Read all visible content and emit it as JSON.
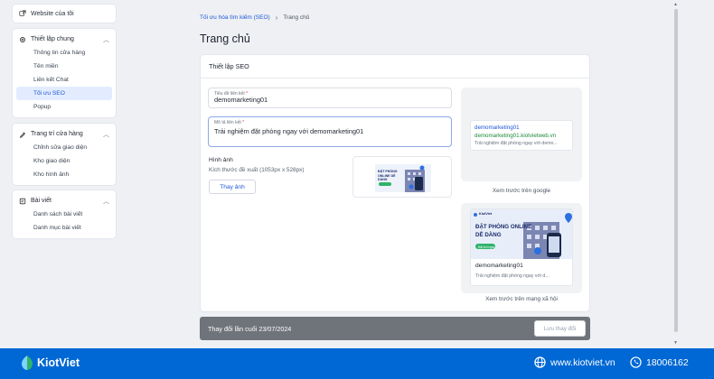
{
  "sidebar": {
    "top_item": "Website của tôi",
    "groups": [
      {
        "title": "Thiết lập chung",
        "items": [
          "Thông tin cửa hàng",
          "Tên miền",
          "Liên kết Chat",
          "Tối ưu SEO",
          "Popup"
        ]
      },
      {
        "title": "Trang trí cửa hàng",
        "items": [
          "Chỉnh sửa giao diện",
          "Kho giao diện",
          "Kho hình ảnh"
        ]
      },
      {
        "title": "Bài viết",
        "items": [
          "Danh sách bài viết",
          "Danh mục bài viết"
        ]
      }
    ],
    "active_item": "Tối ưu SEO"
  },
  "breadcrumb": {
    "parent": "Tối ưu hóa tìm kiếm (SEO)",
    "current": "Trang chủ"
  },
  "page_title": "Trang chủ",
  "seo_card": {
    "title": "Thiết lập SEO",
    "link_title_label": "Tiêu đề liên kết",
    "link_title_value": "demomarketing01",
    "link_desc_label": "Mô tả liên kết",
    "link_desc_value": "Trải nghiệm đặt phòng ngay với demomarketing01",
    "required_mark": "*",
    "image_title": "Hình ảnh",
    "image_hint": "Kích thước đề xuất (1053px x 528px)",
    "change_image_button": "Thay ảnh",
    "thumbnail_text": "ĐẶT PHÒNG ONLINE DỄ DÀNG"
  },
  "google_preview": {
    "title": "demomarketing01",
    "url": "demomarketing01.kiotvietweb.vn",
    "description": "Trải nghiệm đặt phòng ngay với demo...",
    "caption": "Xem trước trên google"
  },
  "social_preview": {
    "banner_brand": "KiotViet",
    "banner_line1": "ĐẶT PHÒNG ONLINE",
    "banner_line2": "DỄ DÀNG",
    "banner_button": "Đặt lịch ngay",
    "title": "demomarketing01",
    "description": "Trải nghiệm đặt phòng ngay với d...",
    "caption": "Xem trước trên mạng xã hội"
  },
  "save_bar": {
    "last_modified": "Thay đổi lần cuối 23/07/2024",
    "save_button": "Lưu thay đổi"
  },
  "footer": {
    "brand": "KiotViet",
    "website": "www.kiotviet.vn",
    "phone": "18006162"
  },
  "colors": {
    "accent": "#1c57d6",
    "footer_bg": "#0068d4",
    "url_green": "#1e8a3a",
    "save_bar_bg": "#6f737a"
  }
}
